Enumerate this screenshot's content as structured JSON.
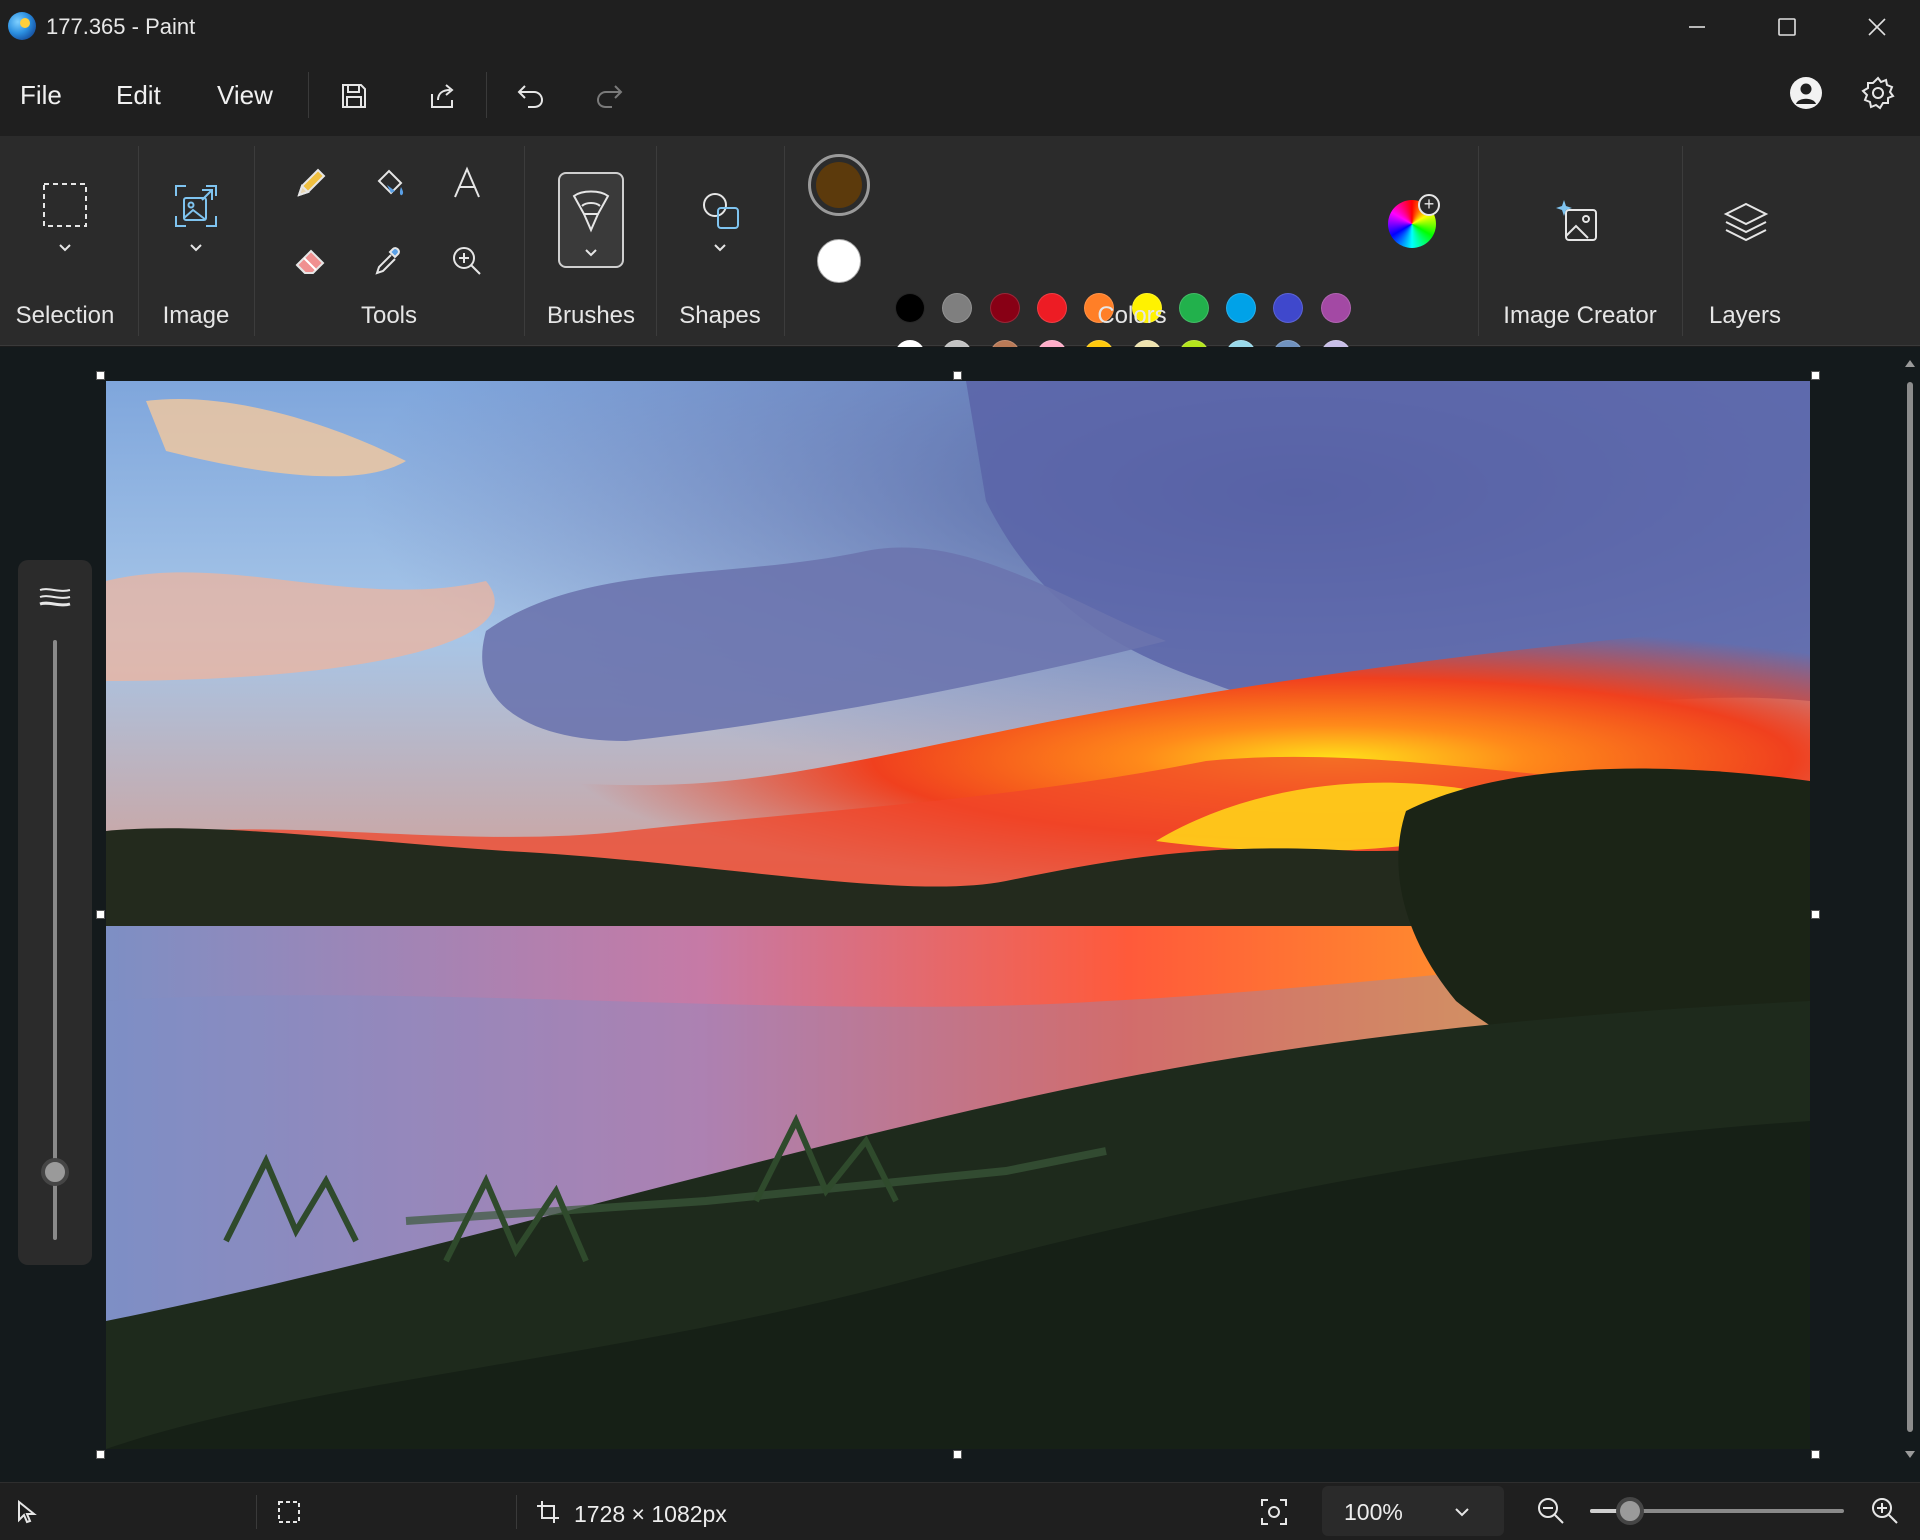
{
  "window": {
    "title": "177.365 - Paint"
  },
  "menu": {
    "file": "File",
    "edit": "Edit",
    "view": "View"
  },
  "ribbon": {
    "groups": {
      "selection": "Selection",
      "image": "Image",
      "tools": "Tools",
      "brushes": "Brushes",
      "shapes": "Shapes",
      "colors": "Colors",
      "image_creator": "Image Creator",
      "layers": "Layers"
    },
    "colors": {
      "primary": "#5c3a0c",
      "secondary": "#ffffff",
      "palette": [
        [
          "#000000",
          "#7f7f7f",
          "#880015",
          "#ed1c24",
          "#ff7f27",
          "#fff200",
          "#22b14c",
          "#00a2e8",
          "#3f48cc",
          "#a349a4"
        ],
        [
          "#ffffff",
          "#c3c3c3",
          "#b97a57",
          "#ffaec9",
          "#ffc90e",
          "#efe4b0",
          "#b5e61d",
          "#99d9ea",
          "#7092be",
          "#c8bfe7"
        ],
        [
          "#1d2b1c",
          "#c35b68",
          "#2a4a2e",
          "#243322",
          "#1e261c",
          "#96c6e8",
          "#c6e6f7",
          "#3a3013",
          "#3b2611",
          "#6b4a14"
        ]
      ]
    }
  },
  "status": {
    "canvas_size": "1728 × 1082px",
    "zoom": "100%",
    "zoom_level": 0.1
  }
}
